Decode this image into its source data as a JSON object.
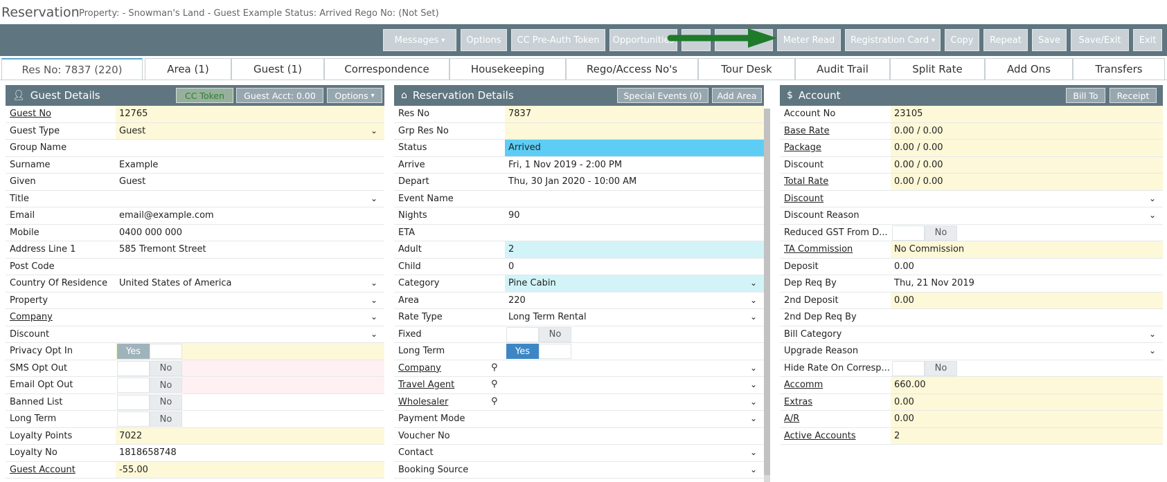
{
  "title": {
    "app": "Reservation",
    "meta": "Property: - Snowman's Land -  Guest Example   Status: Arrived Rego No: (Not Set)"
  },
  "toolbar": {
    "messages": "Messages",
    "options": "Options",
    "cc_preauth": "CC Pre-Auth Token",
    "opportunities": "Opportunities",
    "hidden1": "",
    "hidden2": "",
    "meter_read": "Meter Read",
    "registration_card": "Registration Card",
    "copy": "Copy",
    "repeat": "Repeat",
    "save": "Save",
    "save_exit": "Save/Exit",
    "exit": "Exit"
  },
  "tabs": [
    "Res No: 7837 (220)",
    "Area (1)",
    "Guest (1)",
    "Correspondence",
    "Housekeeping",
    "Rego/Access No's",
    "Tour Desk",
    "Audit Trail",
    "Split Rate",
    "Add Ons",
    "Transfers"
  ],
  "guest": {
    "title": "Guest Details",
    "cc_token": "CC Token",
    "guest_acct": "Guest Acct: 0.00",
    "options": "Options",
    "rows": [
      {
        "label": "Guest No",
        "value": "12765"
      },
      {
        "label": "Guest Type",
        "value": "Guest"
      },
      {
        "label": "Group Name",
        "value": ""
      },
      {
        "label": "Surname",
        "value": "Example"
      },
      {
        "label": "Given",
        "value": "Guest"
      },
      {
        "label": "Title",
        "value": ""
      },
      {
        "label": "Email",
        "value": "email@example.com"
      },
      {
        "label": "Mobile",
        "value": "0400 000 000"
      },
      {
        "label": "Address Line 1",
        "value": "585 Tremont Street"
      },
      {
        "label": "Post Code",
        "value": ""
      },
      {
        "label": "Country Of Residence",
        "value": "United States of America"
      },
      {
        "label": "Property",
        "value": ""
      },
      {
        "label": "Company",
        "value": ""
      },
      {
        "label": "Discount",
        "value": ""
      },
      {
        "label": "Privacy Opt In",
        "value": "Yes"
      },
      {
        "label": "SMS Opt Out",
        "value": "No"
      },
      {
        "label": "Email Opt Out",
        "value": "No"
      },
      {
        "label": "Banned List",
        "value": "No"
      },
      {
        "label": "Long Term",
        "value": "No"
      },
      {
        "label": "Loyalty Points",
        "value": "7022"
      },
      {
        "label": "Loyalty No",
        "value": "1818658748"
      },
      {
        "label": "Guest Account",
        "value": "-55.00"
      }
    ]
  },
  "reservation": {
    "title": "Reservation Details",
    "special_events": "Special Events (0)",
    "add_area": "Add Area",
    "rows": [
      {
        "label": "Res No",
        "value": "7837"
      },
      {
        "label": "Grp Res No",
        "value": ""
      },
      {
        "label": "Status",
        "value": "Arrived"
      },
      {
        "label": "Arrive",
        "value": "Fri, 1 Nov 2019 - 2:00 PM"
      },
      {
        "label": "Depart",
        "value": "Thu, 30 Jan 2020 - 10:00 AM"
      },
      {
        "label": "Event Name",
        "value": ""
      },
      {
        "label": "Nights",
        "value": "90"
      },
      {
        "label": "ETA",
        "value": ""
      },
      {
        "label": "Adult",
        "value": "2"
      },
      {
        "label": "Child",
        "value": "0"
      },
      {
        "label": "Category",
        "value": "Pine Cabin"
      },
      {
        "label": "Area",
        "value": "220"
      },
      {
        "label": "Rate Type",
        "value": "Long Term Rental"
      },
      {
        "label": "Fixed",
        "value": "No"
      },
      {
        "label": "Long Term",
        "value": "Yes"
      },
      {
        "label": "Company",
        "value": ""
      },
      {
        "label": "Travel Agent",
        "value": ""
      },
      {
        "label": "Wholesaler",
        "value": ""
      },
      {
        "label": "Payment Mode",
        "value": ""
      },
      {
        "label": "Voucher No",
        "value": ""
      },
      {
        "label": "Contact",
        "value": ""
      },
      {
        "label": "Booking Source",
        "value": ""
      }
    ]
  },
  "account": {
    "title": "Account",
    "bill_to": "Bill To",
    "receipt": "Receipt",
    "rows": [
      {
        "label": "Account No",
        "value": "23105"
      },
      {
        "label": "Base Rate",
        "value": "0.00 / 0.00"
      },
      {
        "label": "Package",
        "value": "0.00 / 0.00"
      },
      {
        "label": "Discount",
        "value": "0.00 / 0.00"
      },
      {
        "label": "Total Rate",
        "value": "0.00 / 0.00"
      },
      {
        "label": "Discount",
        "value": ""
      },
      {
        "label": "Discount Reason",
        "value": ""
      },
      {
        "label": "Reduced GST From D...",
        "value": "No"
      },
      {
        "label": "TA Commission",
        "value": "No Commission"
      },
      {
        "label": "Deposit",
        "value": "0.00"
      },
      {
        "label": "Dep Req By",
        "value": "Thu, 21 Nov 2019"
      },
      {
        "label": "2nd Deposit",
        "value": "0.00"
      },
      {
        "label": "2nd Dep Req By",
        "value": ""
      },
      {
        "label": "Bill Category",
        "value": ""
      },
      {
        "label": "Upgrade Reason",
        "value": ""
      },
      {
        "label": "Hide Rate On Corresp...",
        "value": "No"
      },
      {
        "label": "Accomm",
        "value": "660.00"
      },
      {
        "label": "Extras",
        "value": "0.00"
      },
      {
        "label": "A/R",
        "value": "0.00"
      },
      {
        "label": "Active Accounts",
        "value": "2"
      }
    ]
  },
  "colors": {
    "toolbar": "#5f7580",
    "status_arrived": "#5dcdf5",
    "highlight": "#fdf8d8",
    "arrow": "#1f7a2a"
  }
}
